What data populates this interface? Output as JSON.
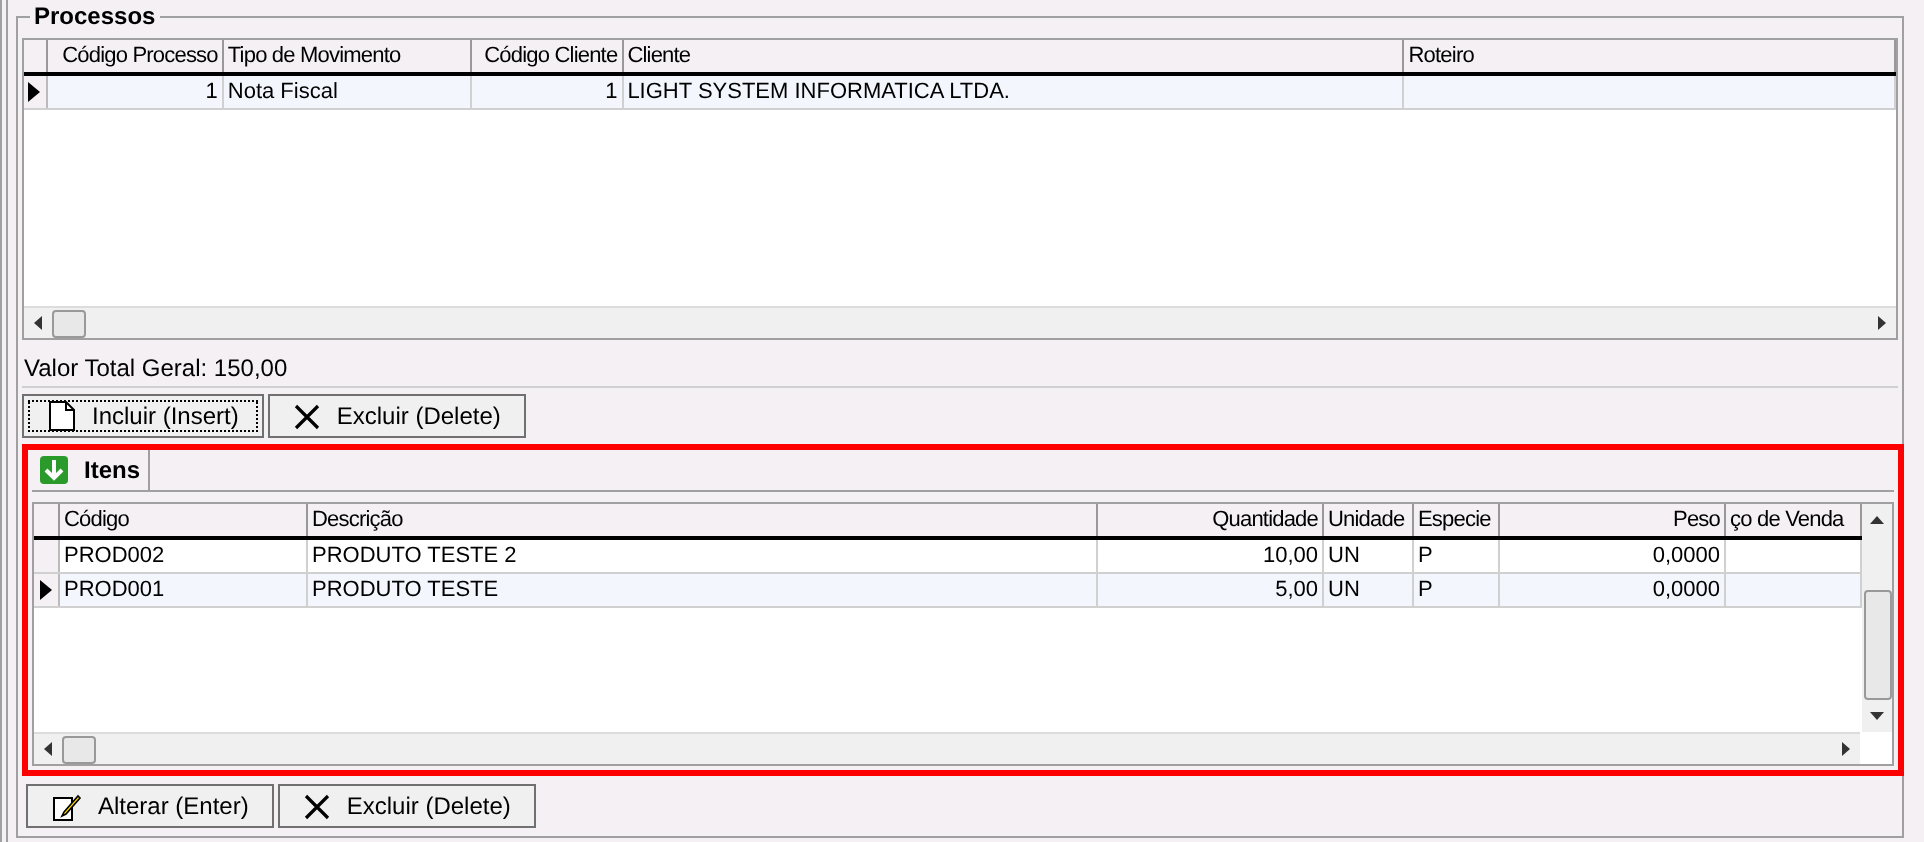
{
  "processos": {
    "title": "Processos",
    "columns": [
      "Código Processo",
      "Tipo de Movimento",
      "Código Cliente",
      "Cliente",
      "Roteiro"
    ],
    "rows": [
      {
        "selected": true,
        "cells": [
          "1",
          "Nota Fiscal",
          "1",
          "LIGHT SYSTEM INFORMATICA LTDA.",
          ""
        ]
      }
    ]
  },
  "total": "Valor Total Geral: 150,00",
  "buttons": [
    {
      "kind": "new",
      "label": "Incluir (Insert)",
      "focused": true
    },
    {
      "kind": "delete",
      "label": "Excluir (Delete)",
      "focused": false
    }
  ],
  "itens": {
    "tab": {
      "label": "Itens",
      "selected": true
    },
    "columns": [
      "Código",
      "Descrição",
      "Quantidade",
      "Unidade",
      "Especie",
      "Peso",
      "ço de Venda"
    ],
    "rows": [
      {
        "selected": false,
        "cells": [
          "PROD002",
          "PRODUTO TESTE 2",
          "10,00",
          "UN",
          "P",
          "0,0000",
          ""
        ]
      },
      {
        "selected": true,
        "cells": [
          "PROD001",
          "PRODUTO TESTE",
          "5,00",
          "UN",
          "P",
          "0,0000",
          ""
        ]
      }
    ]
  },
  "bottom_buttons": [
    {
      "kind": "edit",
      "label": "Alterar (Enter)",
      "focused": false
    },
    {
      "kind": "delete",
      "label": "Excluir (Delete)",
      "focused": false
    }
  ]
}
